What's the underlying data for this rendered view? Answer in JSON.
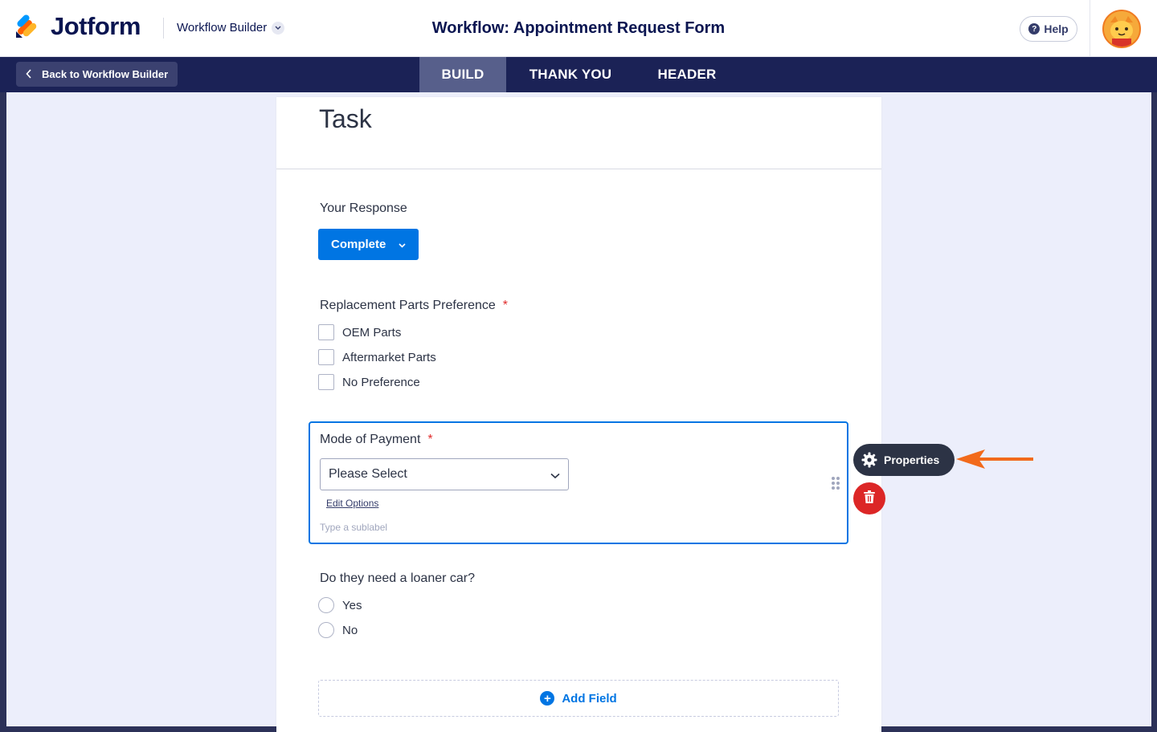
{
  "app": {
    "brand": "Jotform",
    "workflow_menu": "Workflow Builder",
    "title": "Workflow: Appointment Request Form",
    "help_label": "Help"
  },
  "nav": {
    "back_label": "Back to Workflow Builder",
    "tabs": [
      {
        "label": "BUILD",
        "active": true
      },
      {
        "label": "THANK YOU",
        "active": false
      },
      {
        "label": "HEADER",
        "active": false
      }
    ]
  },
  "form": {
    "task_title": "Task",
    "response": {
      "label": "Your Response",
      "button": "Complete"
    },
    "parts": {
      "label": "Replacement Parts Preference",
      "required_mark": "*",
      "options": [
        "OEM Parts",
        "Aftermarket Parts",
        "No Preference"
      ]
    },
    "payment": {
      "label": "Mode of Payment",
      "required_mark": "*",
      "select_value": "Please Select",
      "edit_options": "Edit Options",
      "sublabel_placeholder": "Type a sublabel"
    },
    "loaner": {
      "label": "Do they need a loaner car?",
      "options": [
        "Yes",
        "No"
      ]
    },
    "add_field": "Add Field"
  },
  "toolbar": {
    "properties_label": "Properties"
  },
  "colors": {
    "brand_navy": "#0a1551",
    "nav_bg": "#1b2256",
    "accent_blue": "#0075e3",
    "danger": "#dc2626",
    "annotation_orange": "#f26a1b"
  }
}
